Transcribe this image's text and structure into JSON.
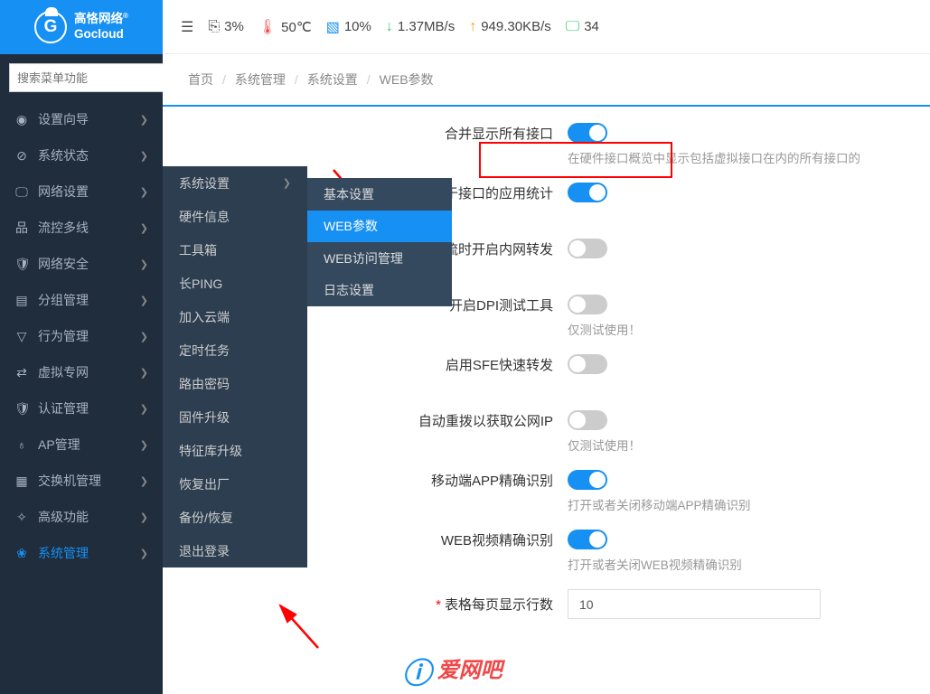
{
  "logo": {
    "line1": "高恪网络",
    "line2": "Gocloud"
  },
  "stats": {
    "cpu": "3%",
    "temp": "50℃",
    "mem": "10%",
    "down": "1.37MB/s",
    "up": "949.30KB/s",
    "conn": "34"
  },
  "search": {
    "placeholder": "搜索菜单功能"
  },
  "nav": [
    {
      "icon": "◉",
      "label": "设置向导"
    },
    {
      "icon": "⊘",
      "label": "系统状态"
    },
    {
      "icon": "🖵",
      "label": "网络设置"
    },
    {
      "icon": "品",
      "label": "流控多线"
    },
    {
      "icon": "🛡",
      "label": "网络安全"
    },
    {
      "icon": "▤",
      "label": "分组管理"
    },
    {
      "icon": "▽",
      "label": "行为管理"
    },
    {
      "icon": "⇄",
      "label": "虚拟专网"
    },
    {
      "icon": "🛡",
      "label": "认证管理"
    },
    {
      "icon": "♁",
      "label": "AP管理"
    },
    {
      "icon": "▦",
      "label": "交换机管理"
    },
    {
      "icon": "✧",
      "label": "高级功能"
    },
    {
      "icon": "❀",
      "label": "系统管理",
      "active": true
    }
  ],
  "submenu": [
    {
      "label": "系统设置",
      "arrow": true
    },
    {
      "label": "硬件信息"
    },
    {
      "label": "工具箱"
    },
    {
      "label": "长PING"
    },
    {
      "label": "加入云端"
    },
    {
      "label": "定时任务"
    },
    {
      "label": "路由密码"
    },
    {
      "label": "固件升级"
    },
    {
      "label": "特征库升级"
    },
    {
      "label": "恢复出厂"
    },
    {
      "label": "备份/恢复"
    },
    {
      "label": "退出登录"
    }
  ],
  "submenu2": [
    {
      "label": "基本设置"
    },
    {
      "label": "WEB参数",
      "sel": true
    },
    {
      "label": "WEB访问管理"
    },
    {
      "label": "日志设置"
    }
  ],
  "breadcrumb": [
    "首页",
    "系统管理",
    "系统设置",
    "WEB参数"
  ],
  "settings": {
    "merge_display": {
      "label": "合并显示所有接口",
      "on": true,
      "hint": "在硬件接口概览中显示包括虚拟接口在内的所有接口的"
    },
    "app_stats": {
      "label": "基于接口的应用统计",
      "on": true
    },
    "multi_forward": {
      "label": "多线分流时开启内网转发",
      "on": false
    },
    "dpi": {
      "label": "开启DPI测试工具",
      "on": false,
      "hint": "仅测试使用！"
    },
    "sfe": {
      "label": "启用SFE快速转发",
      "on": false
    },
    "redial": {
      "label": "自动重拨以获取公网IP",
      "on": false,
      "hint": "仅测试使用！"
    },
    "app_detect": {
      "label": "移动端APP精确识别",
      "on": true,
      "hint": "打开或者关闭移动端APP精确识别"
    },
    "video_detect": {
      "label": "WEB视频精确识别",
      "on": true,
      "hint": "打开或者关闭WEB视频精确识别"
    },
    "page_rows": {
      "label": "表格每页显示行数",
      "value": "10"
    }
  },
  "watermark": "爱网吧"
}
